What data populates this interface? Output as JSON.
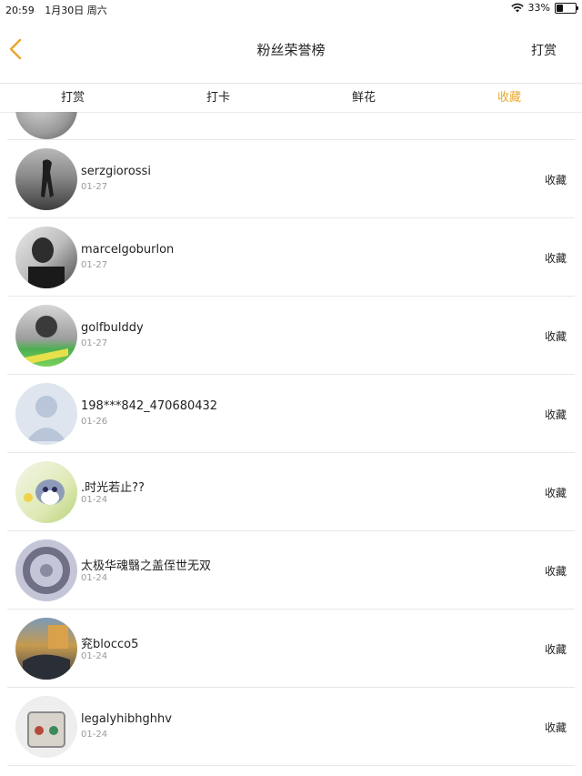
{
  "status_bar": {
    "time": "20:59",
    "date": "1月30日 周六",
    "battery": "33%",
    "battery_level": 0.33
  },
  "nav": {
    "title": "粉丝荣誉榜",
    "action": "打赏"
  },
  "tabs": [
    {
      "label": "打赏",
      "active": false
    },
    {
      "label": "打卡",
      "active": false
    },
    {
      "label": "鲜花",
      "active": false
    },
    {
      "label": "收藏",
      "active": true
    }
  ],
  "accent_color": "#e9a92e",
  "items": [
    {
      "name": "serzgiorossi",
      "date": "01-27",
      "tag": "收藏"
    },
    {
      "name": "marcelgoburlon",
      "date": "01-27",
      "tag": "收藏"
    },
    {
      "name": "golfbulddy",
      "date": "01-27",
      "tag": "收藏"
    },
    {
      "name": "198***842_470680432",
      "date": "01-26",
      "tag": "收藏"
    },
    {
      "name": ".时光若止??",
      "date": "01-24",
      "tag": "收藏"
    },
    {
      "name": "太极华魂翳之盖侄世无双",
      "date": "01-24",
      "tag": "收藏"
    },
    {
      "name": "兖blocco5",
      "date": "01-24",
      "tag": "收藏"
    },
    {
      "name": "legalyhibhghhv",
      "date": "01-24",
      "tag": "收藏"
    }
  ]
}
